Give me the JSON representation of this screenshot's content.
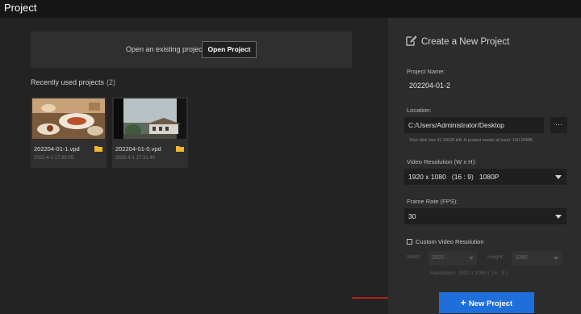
{
  "window": {
    "title": "Project"
  },
  "open_existing": {
    "text": "Open an existing project",
    "button": "Open Project"
  },
  "recent": {
    "label": "Recently used projects",
    "count": "(2)",
    "items": [
      {
        "name": "202204-01-1.vpd",
        "date": "2022-4-1 17:35:05",
        "thumb_icon": "food-table-photo"
      },
      {
        "name": "202204-01-0.vpd",
        "date": "2022-4-1 17:31:40",
        "thumb_icon": "building-photo"
      }
    ]
  },
  "new_project": {
    "title": "Create a New Project",
    "name_label": "Project Name:",
    "name_value": "202204-01-2",
    "location_label": "Location:",
    "location_value": "C:/Users/Administrator/Desktop",
    "browse_label": "···",
    "disk_hint": "Your disk has 41.59GB left. A project needs at least: 100.00MB.",
    "resolution_label": "Video Resolution (W x H):",
    "resolution_value": "1920 x 1080   (16 : 9)   1080P",
    "fps_label": "Frame Rate (FPS):",
    "fps_value": "30",
    "custom_label": "Custom Video Resolution",
    "width_label": "Width:",
    "width_value": "1920",
    "height_label": "Height",
    "height_value": "1080",
    "resolution_note": "Resolution: 1920 x 1080 ( 16 : 9 )",
    "create_button": "New Project"
  },
  "colors": {
    "accent": "#1e6fd9",
    "arrow": "#e02020",
    "folder": "#f2b630"
  }
}
